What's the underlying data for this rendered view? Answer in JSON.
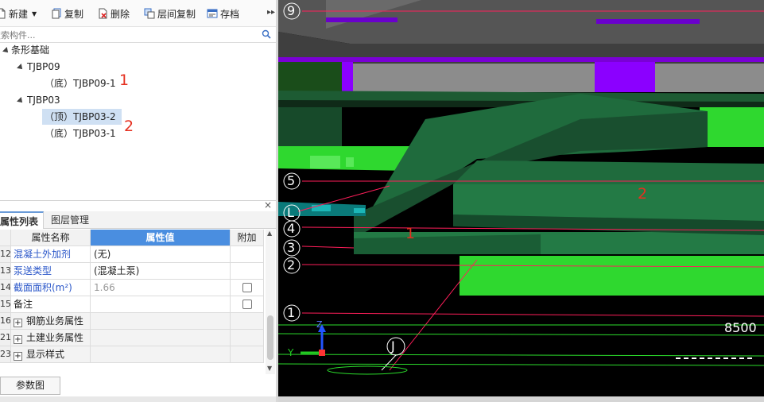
{
  "toolbar": {
    "new_label": "新建",
    "copy_label": "复制",
    "delete_label": "删除",
    "floor_copy_label": "层间复制",
    "archive_label": "存档"
  },
  "search": {
    "placeholder": "搜索构件..."
  },
  "tree": {
    "root": "条形基础",
    "groups": [
      {
        "name": "TJBP09",
        "items": [
          "（底）TJBP09-1"
        ]
      },
      {
        "name": "TJBP03",
        "items": [
          "（顶）TJBP03-2",
          "（底）TJBP03-1"
        ]
      }
    ],
    "annotations": [
      "1",
      "2"
    ]
  },
  "props": {
    "tabs": [
      "属性列表",
      "图层管理"
    ],
    "close": "×",
    "headers": {
      "name": "属性名称",
      "value": "属性值",
      "extra": "附加"
    },
    "rows": [
      {
        "num": "12",
        "name": "混凝土外加剂",
        "value": "(无)"
      },
      {
        "num": "13",
        "name": "泵送类型",
        "value": "(混凝土泵)"
      },
      {
        "num": "14",
        "name": "截面面积(m²)",
        "value": "1.66"
      },
      {
        "num": "15",
        "name": "备注",
        "value": ""
      },
      {
        "num": "16",
        "name": "钢筋业务属性",
        "value": ""
      },
      {
        "num": "21",
        "name": "土建业务属性",
        "value": ""
      },
      {
        "num": "23",
        "name": "显示样式",
        "value": ""
      }
    ],
    "expand_symbol": "+",
    "param_button": "参数图"
  },
  "viewport": {
    "axis_labels": [
      "9",
      "5",
      "L",
      "4",
      "3",
      "2",
      "1",
      "J"
    ],
    "annotations": [
      "1",
      "2"
    ],
    "dimension": "8500",
    "gizmo": {
      "z": "Z",
      "y": "Y"
    },
    "colors": {
      "background": "#000000",
      "foundation": "#1b5e3b",
      "slab": "#33e033",
      "wall": "#8a8a8a",
      "column": "#8b00ff",
      "axis_line": "#ff1e5a"
    }
  }
}
